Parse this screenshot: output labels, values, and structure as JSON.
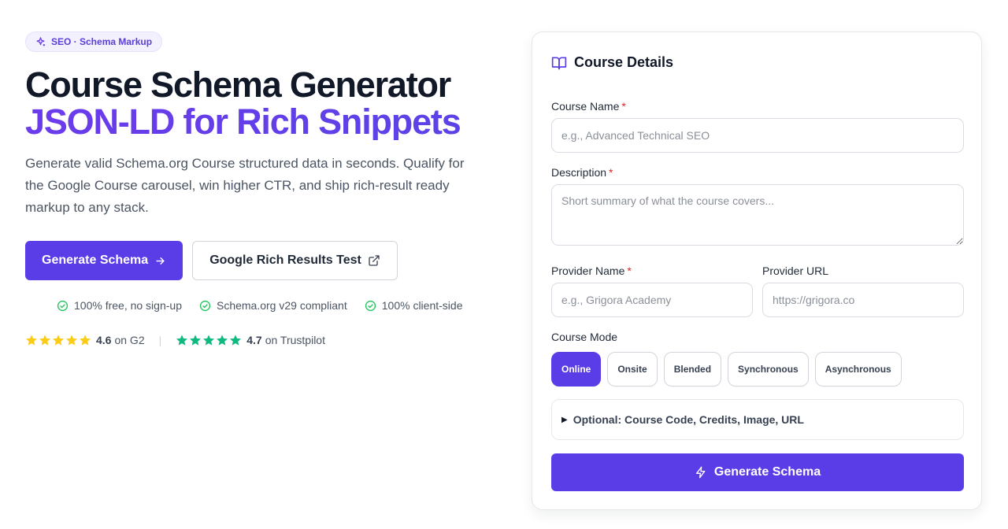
{
  "colors": {
    "accent": "#5b3de8",
    "accent_text": "#6a3ee6",
    "check": "#22c55e",
    "g2_star": "#facc15",
    "trustpilot_star": "#10b981",
    "required": "#dc2626"
  },
  "hero": {
    "badge": {
      "icon": "sparkle-icon",
      "label": "SEO · Schema Markup"
    },
    "title_line1": "Course Schema Generator",
    "title_line2": "JSON-LD for Rich Snippets",
    "lead": "Generate valid Schema.org Course structured data in seconds. Qualify for the Google Course carousel, win higher CTR, and ship rich-result ready markup to any stack.",
    "primary_cta": {
      "label": "Generate Schema",
      "icon": "arrow-right-icon"
    },
    "secondary_cta": {
      "label": "Google Rich Results Test",
      "icon": "external-link-icon"
    },
    "checks": [
      {
        "label": "100% free, no sign-up",
        "icon": "check-circle-icon"
      },
      {
        "label": "Schema.org v29 compliant",
        "icon": "check-circle-icon"
      },
      {
        "label": "100% client-side",
        "icon": "check-circle-icon"
      }
    ],
    "ratings": [
      {
        "stars": 5,
        "value": "4.6",
        "source": "on G2"
      },
      {
        "stars": 5,
        "value": "4.7",
        "source": "on Trustpilot"
      }
    ],
    "rating_separator": "|"
  },
  "form": {
    "title": "Course Details",
    "title_icon": "book-open-icon",
    "course_name": {
      "label": "Course Name",
      "required_mark": "*",
      "placeholder": "e.g., Advanced Technical SEO",
      "value": ""
    },
    "description": {
      "label": "Description",
      "required_mark": "*",
      "placeholder": "Short summary of what the course covers...",
      "value": ""
    },
    "provider_name": {
      "label": "Provider Name",
      "required_mark": "*",
      "placeholder": "e.g., Grigora Academy",
      "value": ""
    },
    "provider_url": {
      "label": "Provider URL",
      "placeholder": "https://grigora.co",
      "value": ""
    },
    "course_mode": {
      "label": "Course Mode",
      "options": [
        "Online",
        "Onsite",
        "Blended",
        "Synchronous",
        "Asynchronous"
      ],
      "selected": "Online"
    },
    "optional_toggle": {
      "marker": "▶",
      "label": "Optional: Course Code, Credits, Image, URL"
    },
    "submit": {
      "label": "Generate Schema",
      "icon": "bolt-icon"
    }
  }
}
